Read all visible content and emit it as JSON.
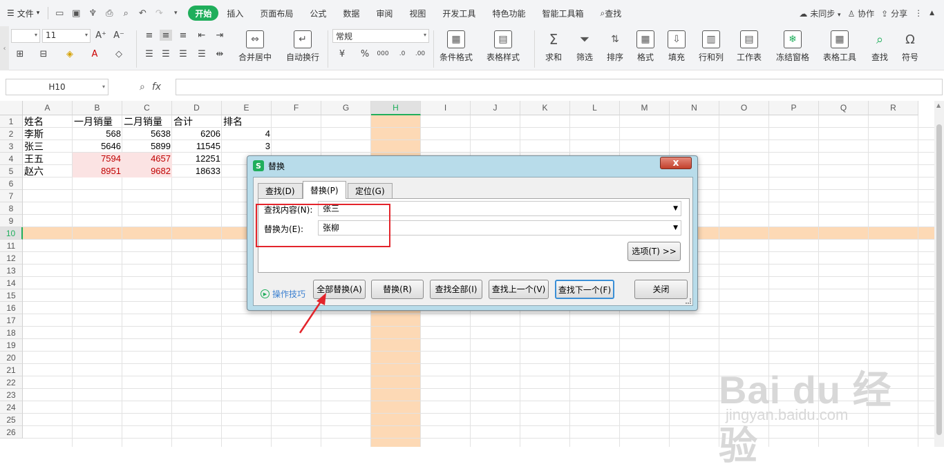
{
  "topbar": {
    "file_label": "文件",
    "tabs": [
      "开始",
      "插入",
      "页面布局",
      "公式",
      "数据",
      "审阅",
      "视图",
      "开发工具",
      "特色功能",
      "智能工具箱"
    ],
    "search_label": "查找",
    "sync_label": "未同步",
    "collab_label": "协作",
    "share_label": "分享"
  },
  "ribbon": {
    "font_name": "",
    "font_size": "11",
    "number_format": "常规",
    "merge_label": "合并居中",
    "wrap_label": "自动换行",
    "cond_format_label": "条件格式",
    "table_style_label": "表格样式",
    "sum_label": "求和",
    "filter_label": "筛选",
    "sort_label": "排序",
    "format_label": "格式",
    "fill_label": "填充",
    "rowcol_label": "行和列",
    "sheet_label": "工作表",
    "freeze_label": "冻结窗格",
    "table_tools_label": "表格工具",
    "find_label": "查找",
    "symbol_label": "符号"
  },
  "formula_bar": {
    "name_box": "H10",
    "fx_label": "fx",
    "formula": ""
  },
  "grid": {
    "columns": [
      "A",
      "B",
      "C",
      "D",
      "E",
      "F",
      "G",
      "H",
      "I",
      "J",
      "K",
      "L",
      "M",
      "N",
      "O",
      "P",
      "Q",
      "R"
    ],
    "selected_column": "H",
    "selected_row": 10,
    "rows": [
      1,
      2,
      3,
      4,
      5,
      6,
      7,
      8,
      9,
      10,
      11,
      12,
      13,
      14,
      15,
      16,
      17,
      18,
      19,
      20,
      21,
      22,
      23,
      24,
      25,
      26
    ],
    "headers": [
      "姓名",
      "一月销量",
      "二月销量",
      "合计",
      "排名"
    ],
    "data": [
      [
        "李斯",
        "568",
        "5638",
        "6206",
        "4"
      ],
      [
        "张三",
        "5646",
        "5899",
        "11545",
        "3"
      ],
      [
        "王五",
        "7594",
        "4657",
        "12251",
        ""
      ],
      [
        "赵六",
        "8951",
        "9682",
        "18633",
        ""
      ]
    ]
  },
  "dialog": {
    "title": "替换",
    "tabs": [
      "查找(D)",
      "替换(P)",
      "定位(G)"
    ],
    "active_tab": "替换(P)",
    "find_label": "查找内容(N):",
    "find_value": "张三",
    "replace_label": "替换为(E):",
    "replace_value": "张柳",
    "options_btn": "选项(T) >>",
    "tips_label": "操作技巧",
    "replace_all_btn": "全部替换(A)",
    "replace_btn": "替换(R)",
    "find_all_btn": "查找全部(I)",
    "find_prev_btn": "查找上一个(V)",
    "find_next_btn": "查找下一个(F)",
    "close_btn": "关闭",
    "close_x": "x"
  },
  "watermark": {
    "logo_text": "Bai du 经验",
    "url_text": "jingyan.baidu.com"
  },
  "colors": {
    "accent": "#1fae5b",
    "highlight": "#fdd9b5",
    "annotation_red": "#e3242b"
  }
}
